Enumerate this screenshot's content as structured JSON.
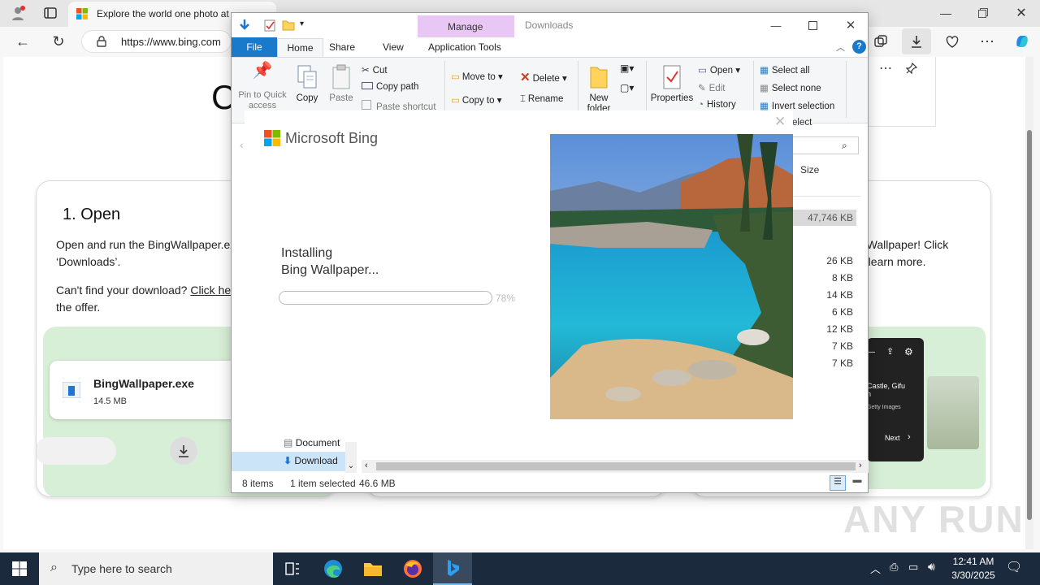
{
  "browser": {
    "tab_title": "Explore the world one photo at",
    "url": "https://www.bing.com"
  },
  "page": {
    "heading_partial": "C",
    "step1_title": "1. Open",
    "step1_text1": "Open and run the BingWallpaper.ex",
    "step1_text2": "‘Downloads’.",
    "step1_text3": "Can't find your download?",
    "step1_link": "Click her",
    "step1_text4": "the offer.",
    "download_name": "BingWallpaper.exe",
    "download_size": "14.5 MB",
    "step3_text1": "g Wallpaper! Click",
    "step3_text2": "d learn more.",
    "phone_text1": "Castle, Gifu",
    "phone_text2": "n",
    "phone_text3": "Getty Images",
    "phone_next": "Next"
  },
  "explorer": {
    "title": "Downloads",
    "context_tab": "Manage",
    "tabs": [
      "File",
      "Home",
      "Share",
      "View",
      "Application Tools"
    ],
    "ribbon": {
      "pin": "Pin to Quick access",
      "copy": "Copy",
      "paste": "Paste",
      "cut": "Cut",
      "copy_path": "Copy path",
      "paste_shortcut": "Paste shortcut",
      "move_to": "Move to",
      "copy_to": "Copy to",
      "delete": "Delete",
      "rename": "Rename",
      "new_folder": "New folder",
      "properties": "Properties",
      "open": "Open",
      "edit": "Edit",
      "history": "History",
      "select_all": "Select all",
      "select_none": "Select none",
      "invert_selection": "Invert selection",
      "select_group": "elect"
    },
    "column_size": "Size",
    "sizes": [
      "47,746 KB",
      "26 KB",
      "8 KB",
      "14 KB",
      "6 KB",
      "12 KB",
      "7 KB",
      "7 KB"
    ],
    "nav_items": [
      "Document",
      "Download"
    ],
    "status_items": "8 items",
    "status_selected": "1 item selected",
    "status_size": "46.6 MB"
  },
  "installer": {
    "brand": "Microsoft Bing",
    "line1": "Installing",
    "line2": "Bing Wallpaper...",
    "progress": 0.78,
    "progress_label": "78%"
  },
  "taskbar": {
    "search_placeholder": "Type here to search",
    "time": "12:41 AM",
    "date": "3/30/2025"
  },
  "watermark": "ANY RUN"
}
